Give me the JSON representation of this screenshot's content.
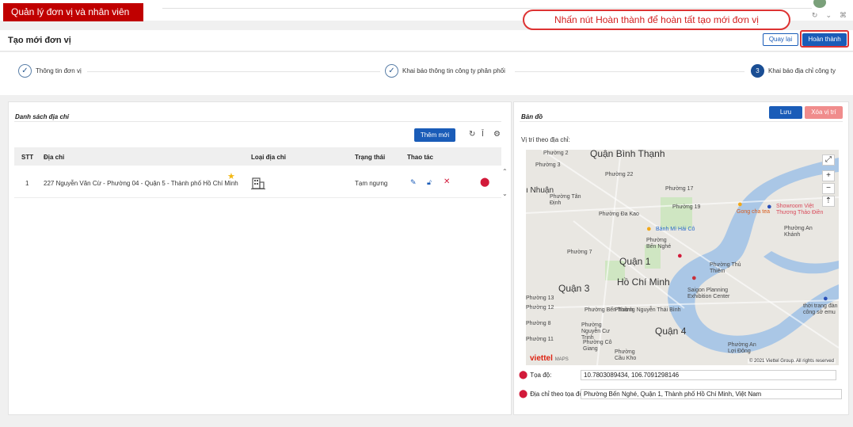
{
  "caption": "Quản lý đơn vị và nhân viên",
  "callout": "Nhấn nút Hoàn thành để hoàn tất tạo mới đơn vị",
  "header": {
    "title": "Tạo mới đơn vị",
    "back_label": "Quay lại",
    "finish_label": "Hoàn thành"
  },
  "steps": [
    {
      "label": "Thông tin đơn vị",
      "status": "done",
      "marker": "✓"
    },
    {
      "label": "Khai báo thông tin công ty phân phối",
      "status": "done",
      "marker": "✓"
    },
    {
      "label": "Khai báo địa chỉ công ty",
      "status": "active",
      "marker": "3"
    }
  ],
  "address_list": {
    "title": "Danh sách địa chỉ",
    "add_label": "Thêm mới",
    "columns": [
      "STT",
      "Địa chỉ",
      "Loại địa chỉ",
      "Trạng thái",
      "Thao tác"
    ],
    "rows": [
      {
        "stt": "1",
        "address": "227 Nguyễn Văn Cừ - Phường 04 - Quận 5 - Thành phố Hồ Chí Minh",
        "type_icon": "building-icon",
        "status": "Tạm ngưng"
      }
    ]
  },
  "map_panel": {
    "title": "Bản đồ",
    "save_label": "Lưu",
    "delete_label": "Xóa vị trí",
    "location_caption": "Vị trí theo địa chỉ:",
    "labels": {
      "quan_binh_thanh": "Quận Bình Thạnh",
      "quan_1": "Quận 1",
      "ho_chi_minh": "Hồ Chí Minh",
      "quan_3": "Quận 3",
      "quan_4": "Quận 4",
      "nhuan": "ı Nhuận",
      "p2": "Phường 2",
      "p3": "Phường 3",
      "p17": "Phường 17",
      "p19": "Phường 19",
      "p22": "Phường 22",
      "tan_dinh": "Phường Tân Định",
      "da_kao": "Phường Đa Kao",
      "ben_nghe": "Phường Bến Nghé",
      "thu_thiem": "Phường Thủ Thiêm",
      "an_khanh": "Phường An Khánh",
      "p7": "Phường 7",
      "ben_thanh": "Phường Bến Thành",
      "nguyen_thai_binh": "Phường Nguyễn Thái Bình",
      "cu_trinh": "Phường Nguyễn Cư Trinh",
      "co_giang": "Phường Cô Giang",
      "cau_kho": "Phường Cầu Kho",
      "an_loi": "Phường An Lợi Đông",
      "p13": "Phường 13",
      "p12": "Phường 12",
      "p8": "Phường 8",
      "p11": "Phường 11",
      "gong_cha": "Gong cha tea",
      "banh_mi": "Bánh Mì Hải Cô",
      "saigon_planning": "Saigon Planning Exhibition Center",
      "showroom": "Showroom Việt Thương Thảo Điền",
      "cong_so": "thời trang đàn công sở emu",
      "attribution": "© 2021 Viettel Group. All rights reserved",
      "viettel": "viettel",
      "maps": "MAPS"
    },
    "coords_label": "Tọa độ:",
    "coords_value": "10.7803089434, 106.7091298146",
    "address_label": "Địa chỉ theo tọa độ:",
    "address_value": "Phường Bến Nghé, Quận 1, Thành phố Hồ Chí Minh, Việt Nam"
  }
}
